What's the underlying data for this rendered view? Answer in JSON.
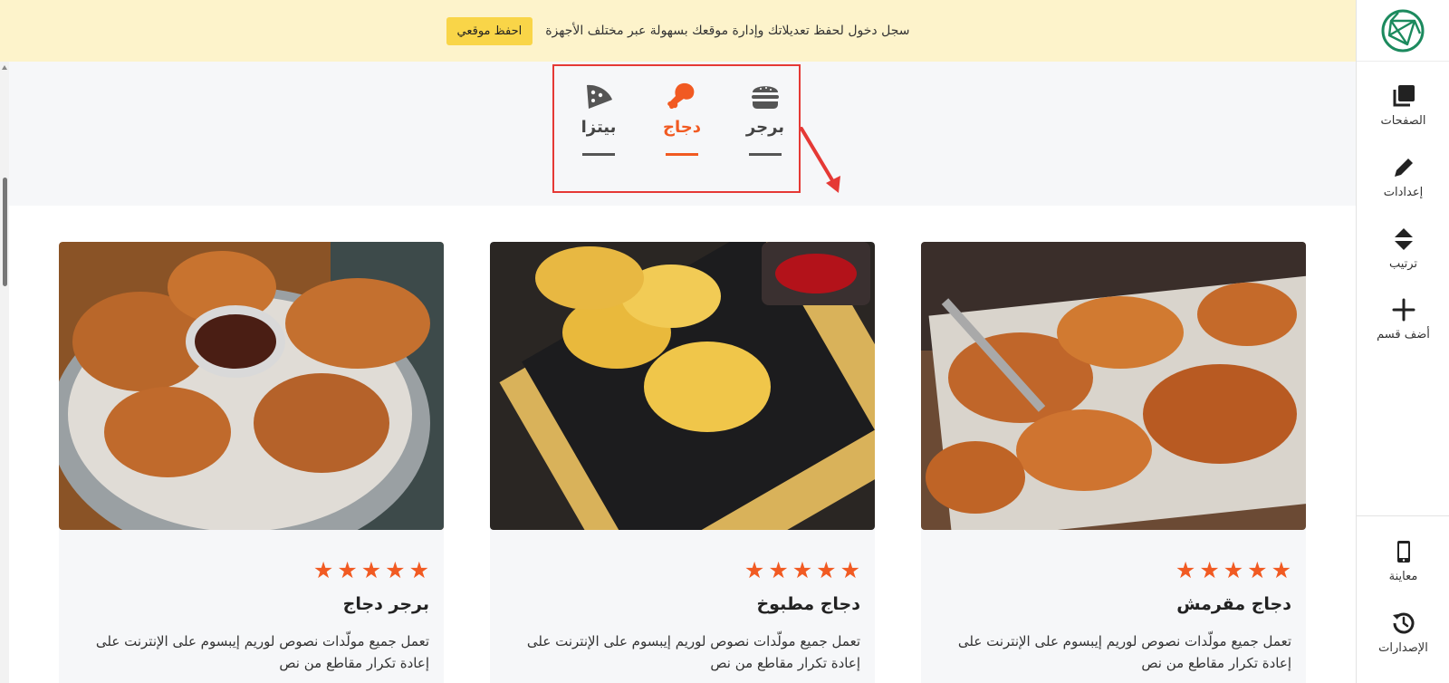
{
  "notice": {
    "message": "سجل دخول لحفظ تعديلاتك وإدارة موقعك بسهولة عبر مختلف الأجهزة",
    "save_label": "احفظ موقعي"
  },
  "sidebar": {
    "items": [
      {
        "label": "الصفحات",
        "icon": "pages-icon"
      },
      {
        "label": "إعدادات",
        "icon": "pencil-icon"
      },
      {
        "label": "ترتيب",
        "icon": "sort-icon"
      },
      {
        "label": "أضف قسم",
        "icon": "plus-icon"
      },
      {
        "label": "معاينة",
        "icon": "mobile-icon"
      },
      {
        "label": "الإصدارات",
        "icon": "history-icon"
      }
    ]
  },
  "tabs": [
    {
      "label": "برجر",
      "icon": "burger-icon",
      "active": false
    },
    {
      "label": "دجاج",
      "icon": "chicken-leg-icon",
      "active": true
    },
    {
      "label": "بيتزا",
      "icon": "pizza-icon",
      "active": false
    }
  ],
  "colors": {
    "accent": "#f15a22",
    "notice_bg": "#fdf3cb",
    "button": "#f9d548",
    "highlight": "#e53935"
  },
  "cards": [
    {
      "title": "دجاج مقرمش",
      "rating": 5,
      "desc_line1": "تعمل جميع مولّدات نصوص لوريم إيبسوم على الإنترنت على",
      "desc_line2": "إعادة تكرار مقاطع من نص"
    },
    {
      "title": "دجاج مطبوخ",
      "rating": 5,
      "desc_line1": "تعمل جميع مولّدات نصوص لوريم إيبسوم على الإنترنت على",
      "desc_line2": "إعادة تكرار مقاطع من نص"
    },
    {
      "title": "برجر دجاج",
      "rating": 5,
      "desc_line1": "تعمل جميع مولّدات نصوص لوريم إيبسوم على الإنترنت على",
      "desc_line2": "إعادة تكرار مقاطع من نص"
    }
  ]
}
